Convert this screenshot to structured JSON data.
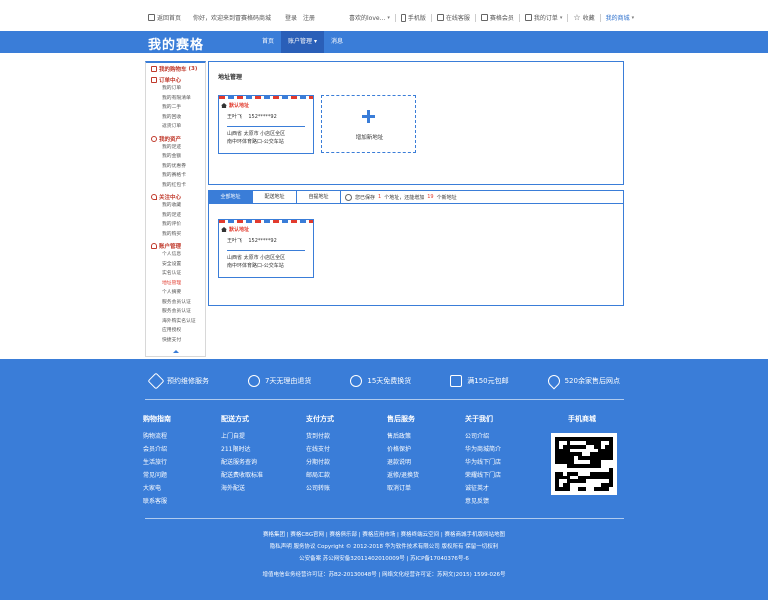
{
  "topbar": {
    "home": "返回首页",
    "greeting": "你好，欢迎来到冒赛格码商城",
    "login": "登录",
    "register": "注册",
    "search_hint": "喜欢的love...",
    "mobile": "手机版",
    "service": "在线客服",
    "member": "赛格会员",
    "orders": "我的订单",
    "favorite": "收藏",
    "mall": "我的商城"
  },
  "header": {
    "brand": "我的赛格",
    "nav": [
      "首页",
      "账户管理",
      "消息"
    ],
    "nav_caret": "▾"
  },
  "sidebar": {
    "cart_label": "我的购物车",
    "cart_count": "(3)",
    "groups": [
      {
        "title": "订单中心",
        "items": [
          "我的订单",
          "我的有限清单",
          "我的二手",
          "我的回收",
          "返货订单"
        ]
      },
      {
        "title": "我的资产",
        "items": [
          "我的足迹",
          "我的金额",
          "我的优惠券",
          "我的赛格卡",
          "我的红包卡"
        ]
      },
      {
        "title": "关注中心",
        "items": [
          "我的收藏",
          "我的足迹",
          "我的评价",
          "我的购买"
        ]
      },
      {
        "title": "账户管理",
        "items": [
          "个人信息",
          "安全设置",
          "实名认证",
          "地址管理",
          "个人摘要",
          "服务会员认证",
          "服务会员认证",
          "海外购实名认证",
          "应用授权",
          "快捷支付"
        ]
      }
    ],
    "active_item": "地址管理"
  },
  "address_panel": {
    "title": "地址管理",
    "card": {
      "tag": "默认地址",
      "name": "王叶飞",
      "phone": "152*****92",
      "address": "山西省 太原市 小店区全区\n南中环体育路口-公交车站"
    },
    "add_label": "增加新地址"
  },
  "tab_panel": {
    "tabs": [
      "全部地址",
      "配送地址",
      "自提地址"
    ],
    "info_prefix": "您已保存",
    "saved_count": "1",
    "info_mid": "个地址，还能增加",
    "remaining_count": "19",
    "info_suffix": "个新地址"
  },
  "footer": {
    "services": [
      "预约维修服务",
      "7天无理由退货",
      "15天免费换货",
      "满150元包邮",
      "520余家售后网点"
    ],
    "columns": [
      {
        "title": "购物指南",
        "links": [
          "购物流程",
          "会员介绍",
          "生活旅行",
          "常见问题",
          "大家电",
          "联系客服"
        ]
      },
      {
        "title": "配送方式",
        "links": [
          "上门自提",
          "211限时达",
          "配送服务查询",
          "配送费收取标准",
          "海外配送"
        ]
      },
      {
        "title": "支付方式",
        "links": [
          "货到付款",
          "在线支付",
          "分期付款",
          "邮局汇款",
          "公司转账"
        ]
      },
      {
        "title": "售后服务",
        "links": [
          "售后政策",
          "价格保护",
          "退款说明",
          "返修/退换货",
          "取消订单"
        ]
      },
      {
        "title": "关于我们",
        "links": [
          "公司介绍",
          "华为商城简介",
          "华为线下门店",
          "荣耀线下门店",
          "诚征英才",
          "意见反馈"
        ]
      }
    ],
    "qr_title": "手机商城",
    "bottom_lines": [
      "赛格集团 | 赛格CBG官网 | 赛格俱乐部 | 赛格应用市场 | 赛格终端云空间 | 赛格商城手机版网站地图",
      "隐私声明 服务协议 Copyright © 2012-2018 华为软件技术有限公司 版权所有 保留一切权利",
      "公安备案 苏公网安备32011402010009号 | 苏ICP备17040376号-6",
      "增值电信业务经营许可证：苏B2-20130048号 | 网络文化经营许可证：苏网文(2015) 1599-026号"
    ]
  },
  "colors": {
    "brand_blue": "#3a7dd8",
    "accent_red": "#e23b2e"
  }
}
